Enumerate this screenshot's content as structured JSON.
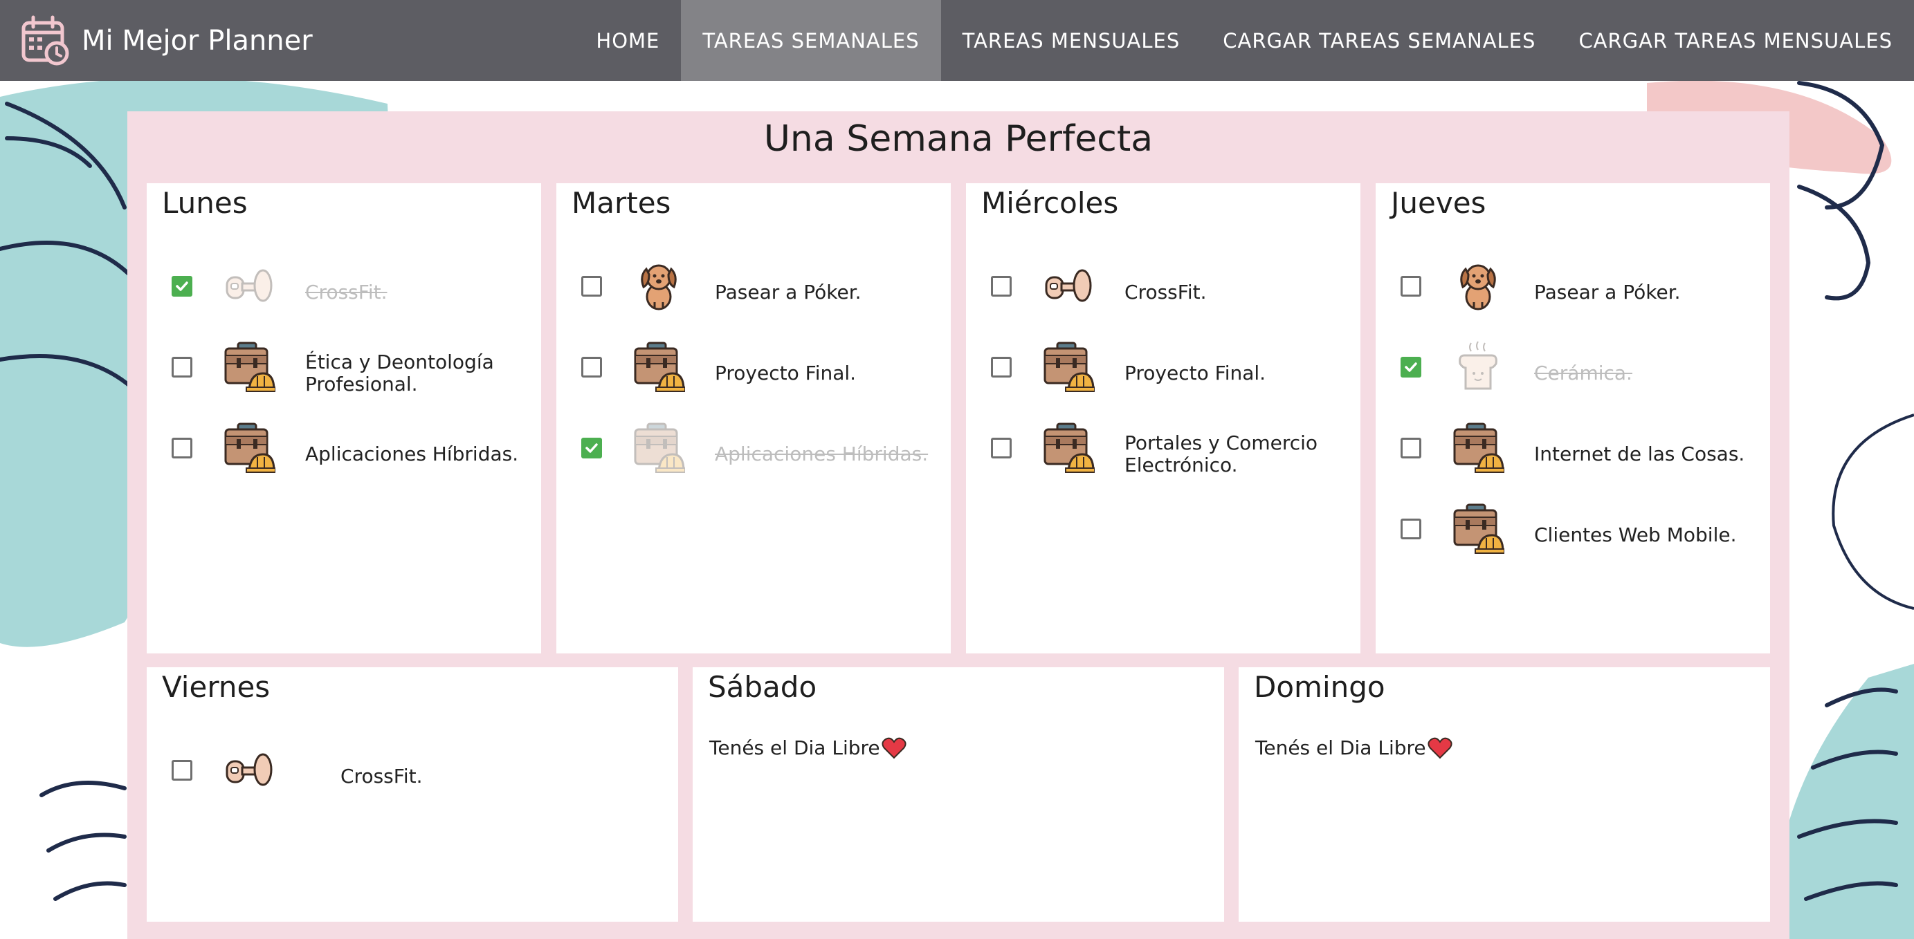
{
  "app": {
    "brand": "Mi Mejor Planner"
  },
  "nav": [
    {
      "label": "HOME"
    },
    {
      "label": "TAREAS SEMANALES",
      "active": true
    },
    {
      "label": "TAREAS MENSUALES"
    },
    {
      "label": "CARGAR TAREAS SEMANALES"
    },
    {
      "label": "CARGAR TAREAS MENSUALES"
    }
  ],
  "page": {
    "title": "Una Semana Perfecta"
  },
  "colors": {
    "navbar": "#5d5d63",
    "nav_active": "#838387",
    "panel": "#f5dce3",
    "check": "#4caf50",
    "heart": "#e53945"
  },
  "days": [
    {
      "name": "Lunes",
      "tasks": [
        {
          "text": "CrossFit.",
          "icon": "dumbbell-icon",
          "done": true
        },
        {
          "text": "Ética y Deontología Profesional.",
          "icon": "briefcase-icon",
          "done": false
        },
        {
          "text": "Aplicaciones Híbridas.",
          "icon": "briefcase-icon",
          "done": false
        }
      ]
    },
    {
      "name": "Martes",
      "tasks": [
        {
          "text": "Pasear a Póker.",
          "icon": "dog-icon",
          "done": false
        },
        {
          "text": "Proyecto Final.",
          "icon": "briefcase-icon",
          "done": false
        },
        {
          "text": "Aplicaciones Híbridas.",
          "icon": "briefcase-icon",
          "done": true
        }
      ]
    },
    {
      "name": "Miércoles",
      "tasks": [
        {
          "text": "CrossFit.",
          "icon": "dumbbell-icon",
          "done": false
        },
        {
          "text": "Proyecto Final.",
          "icon": "briefcase-icon",
          "done": false
        },
        {
          "text": "Portales y Comercio Electrónico.",
          "icon": "briefcase-icon",
          "done": false
        }
      ]
    },
    {
      "name": "Jueves",
      "tasks": [
        {
          "text": "Pasear a Póker.",
          "icon": "dog-icon",
          "done": false
        },
        {
          "text": "Cerámica.",
          "icon": "pottery-icon",
          "done": true
        },
        {
          "text": "Internet de las Cosas.",
          "icon": "briefcase-icon",
          "done": false
        },
        {
          "text": "Clientes Web Mobile.",
          "icon": "briefcase-icon",
          "done": false
        }
      ]
    },
    {
      "name": "Viernes",
      "tasks": [
        {
          "text": "CrossFit.",
          "icon": "dumbbell-icon",
          "done": false
        }
      ]
    },
    {
      "name": "Sábado",
      "tasks": [],
      "free_text": "Tenés el Dia Libre",
      "free_icon": "heart-icon"
    },
    {
      "name": "Domingo",
      "tasks": [],
      "free_text": "Tenés el Dia Libre",
      "free_icon": "heart-icon"
    }
  ]
}
